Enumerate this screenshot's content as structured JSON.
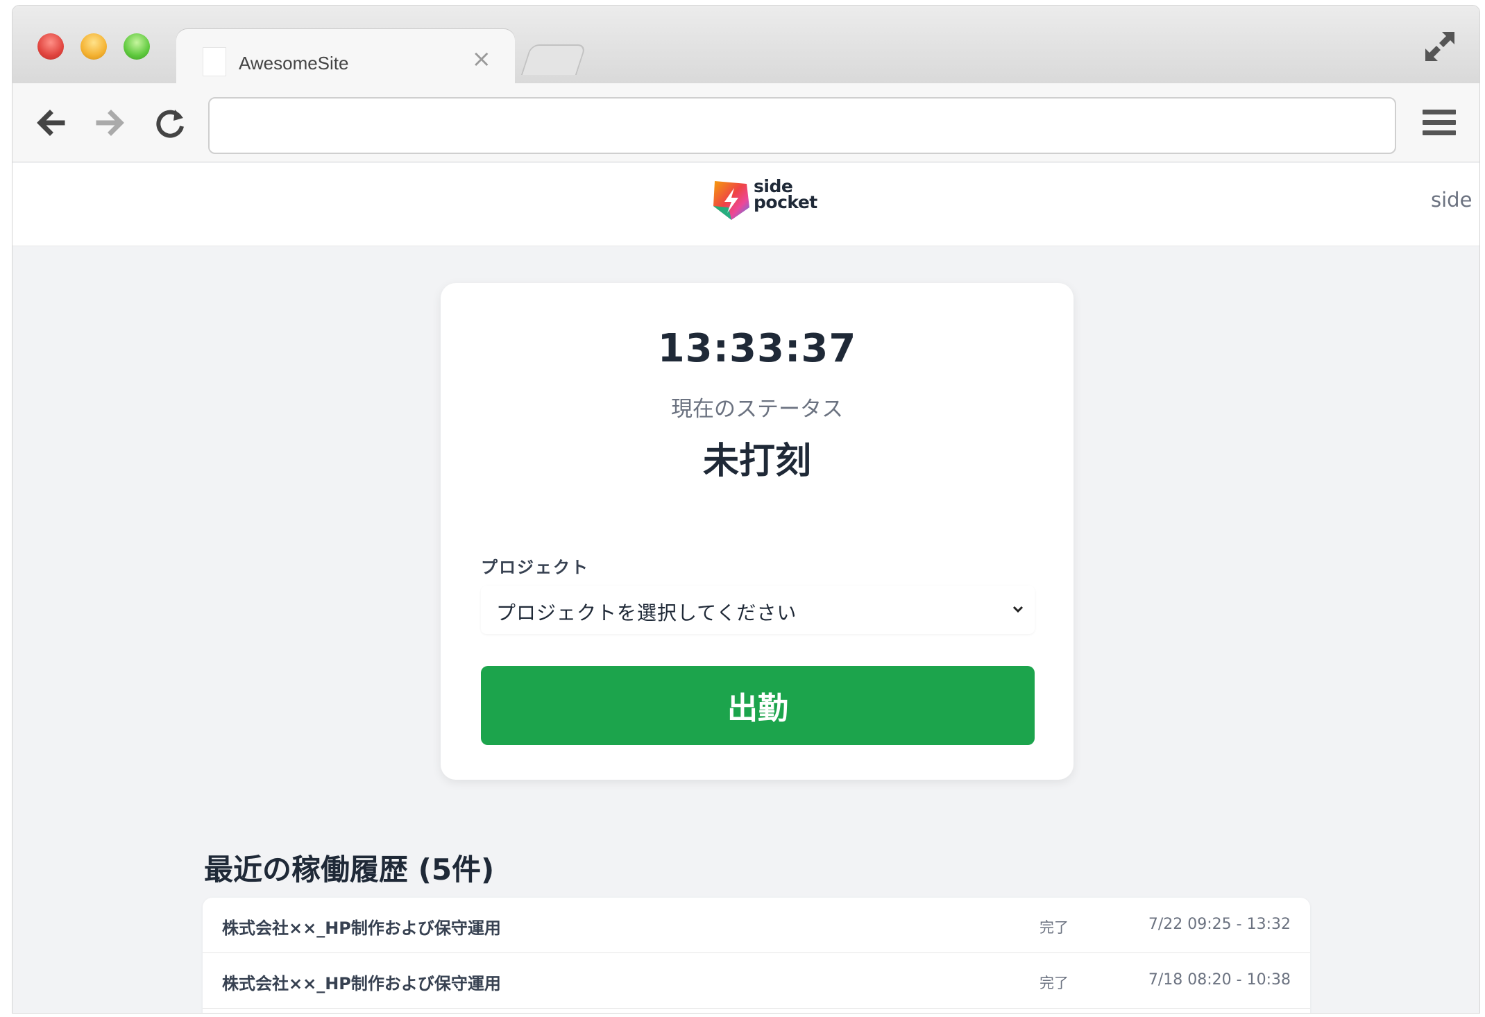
{
  "browser": {
    "tab_title": "AwesomeSite",
    "tab_close": "×",
    "url": ""
  },
  "site": {
    "logo_text_line1": "side",
    "logo_text_line2": "pocket",
    "header_right": "side pocket"
  },
  "card": {
    "clock": "13:33:37",
    "status_label": "現在のステータス",
    "status_value": "未打刻",
    "project_label": "プロジェクト",
    "project_placeholder": "プロジェクトを選択してください",
    "clockin_button": "出勤"
  },
  "history": {
    "title": "最近の稼働履歴 (5件)",
    "rows": [
      {
        "project": "株式会社××_HP制作および保守運用",
        "status": "完了",
        "time": "7/22 09:25  -  13:32"
      },
      {
        "project": "株式会社××_HP制作および保守運用",
        "status": "完了",
        "time": "7/18 08:20  -  10:38"
      }
    ]
  },
  "colors": {
    "primary_button": "#1ca44c",
    "page_background": "#f2f3f5"
  },
  "icons": [
    "back-arrow-icon",
    "forward-arrow-icon",
    "reload-icon",
    "menu-icon",
    "expand-icon",
    "chevron-down-icon",
    "side-pocket-logo-icon"
  ]
}
